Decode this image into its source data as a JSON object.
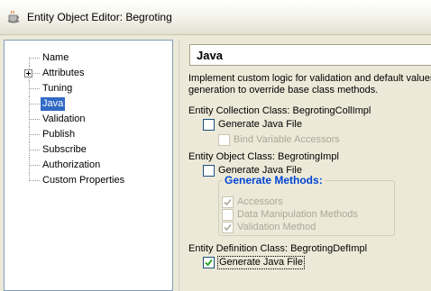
{
  "window": {
    "title": "Entity Object Editor: Begroting"
  },
  "tree": {
    "items": [
      {
        "label": "Name",
        "expandable": false,
        "selected": false
      },
      {
        "label": "Attributes",
        "expandable": true,
        "selected": false
      },
      {
        "label": "Tuning",
        "expandable": false,
        "selected": false
      },
      {
        "label": "Java",
        "expandable": false,
        "selected": true
      },
      {
        "label": "Validation",
        "expandable": false,
        "selected": false
      },
      {
        "label": "Publish",
        "expandable": false,
        "selected": false
      },
      {
        "label": "Subscribe",
        "expandable": false,
        "selected": false
      },
      {
        "label": "Authorization",
        "expandable": false,
        "selected": false
      },
      {
        "label": "Custom Properties",
        "expandable": false,
        "selected": false
      }
    ]
  },
  "panel": {
    "title": "Java",
    "description_line1": "Implement custom logic for validation and default values",
    "description_line2": "generation to override base class methods.",
    "collection": {
      "label": "Entity Collection Class: BegrotingCollImpl",
      "generate_label": "Generate Java File",
      "generate_checked": false,
      "bind_label": "Bind Variable Accessors",
      "bind_checked": false
    },
    "object": {
      "label": "Entity Object Class: BegrotingImpl",
      "generate_label": "Generate Java File",
      "generate_checked": false,
      "methods_title": "Generate Methods:",
      "accessors_label": "Accessors",
      "accessors_checked": true,
      "dml_label": "Data Manipulation Methods",
      "dml_checked": false,
      "validation_label": "Validation Method",
      "validation_checked": true
    },
    "definition": {
      "label": "Entity Definition Class: BegrotingDefImpl",
      "generate_label": "Generate Java File",
      "generate_checked": true
    }
  },
  "colors": {
    "selection": "#316AC5",
    "group_title": "#0046D5",
    "background": "#ECE9D8"
  }
}
